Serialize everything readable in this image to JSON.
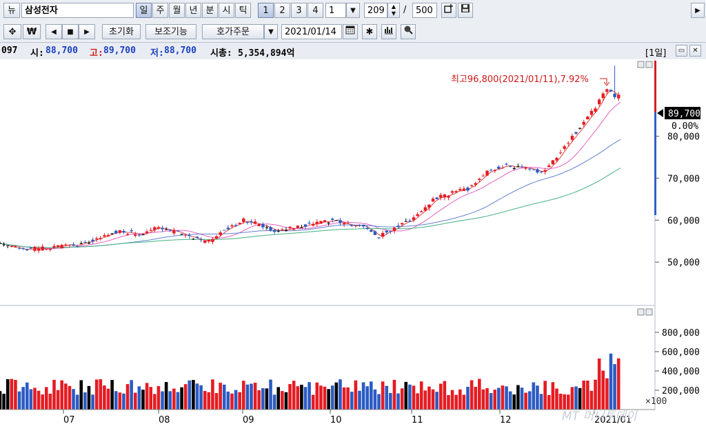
{
  "toolbar": {
    "news_btn": "뉴",
    "stock_name": "삼성전자",
    "periods": [
      "일",
      "주",
      "월",
      "년",
      "분",
      "시",
      "틱"
    ],
    "numbers": [
      "1",
      "2",
      "3",
      "4"
    ],
    "period_num": "1",
    "count_current": "209",
    "count_sep": "/",
    "count_total": "500"
  },
  "toolbar2": {
    "reset_label": "초기화",
    "aux_label": "보조기능",
    "order_label": "호가주문",
    "date": "2021/01/14"
  },
  "info": {
    "code_tail": "097",
    "open_label": "시:",
    "open_value": "88,700",
    "high_label": "고:",
    "high_value": "89,700",
    "low_label": "저:",
    "low_value": "88,700",
    "mcap_label": "시총:",
    "mcap_value": "5,354,894억",
    "interval_label": "[1일]"
  },
  "annotation": {
    "max_label": "최고96,800(2021/01/11),7.92%"
  },
  "current": {
    "price": "89,700",
    "change": "0.00%"
  },
  "colors": {
    "up": "#e51c23",
    "down": "#2c5bc4",
    "flat": "#000000",
    "ma5": "#e04040",
    "ma20": "#e060c0",
    "ma60": "#6080d0",
    "ma120": "#40b080"
  },
  "watermark": "MT 머니투데이",
  "chart_data": {
    "type": "candlestick",
    "x_ticks": [
      "07",
      "08",
      "09",
      "10",
      "11",
      "12",
      "2021/01"
    ],
    "price_ticks": [
      "80,000",
      "70,000",
      "60,000",
      "50,000"
    ],
    "price_range": [
      40000,
      98000
    ],
    "volume_ticks": [
      "800,000",
      "600,000",
      "400,000",
      "200,000"
    ],
    "volume_unit": "×100",
    "volume_range": [
      0,
      1000000
    ],
    "max_price": 96800,
    "last_close": 89700
  }
}
